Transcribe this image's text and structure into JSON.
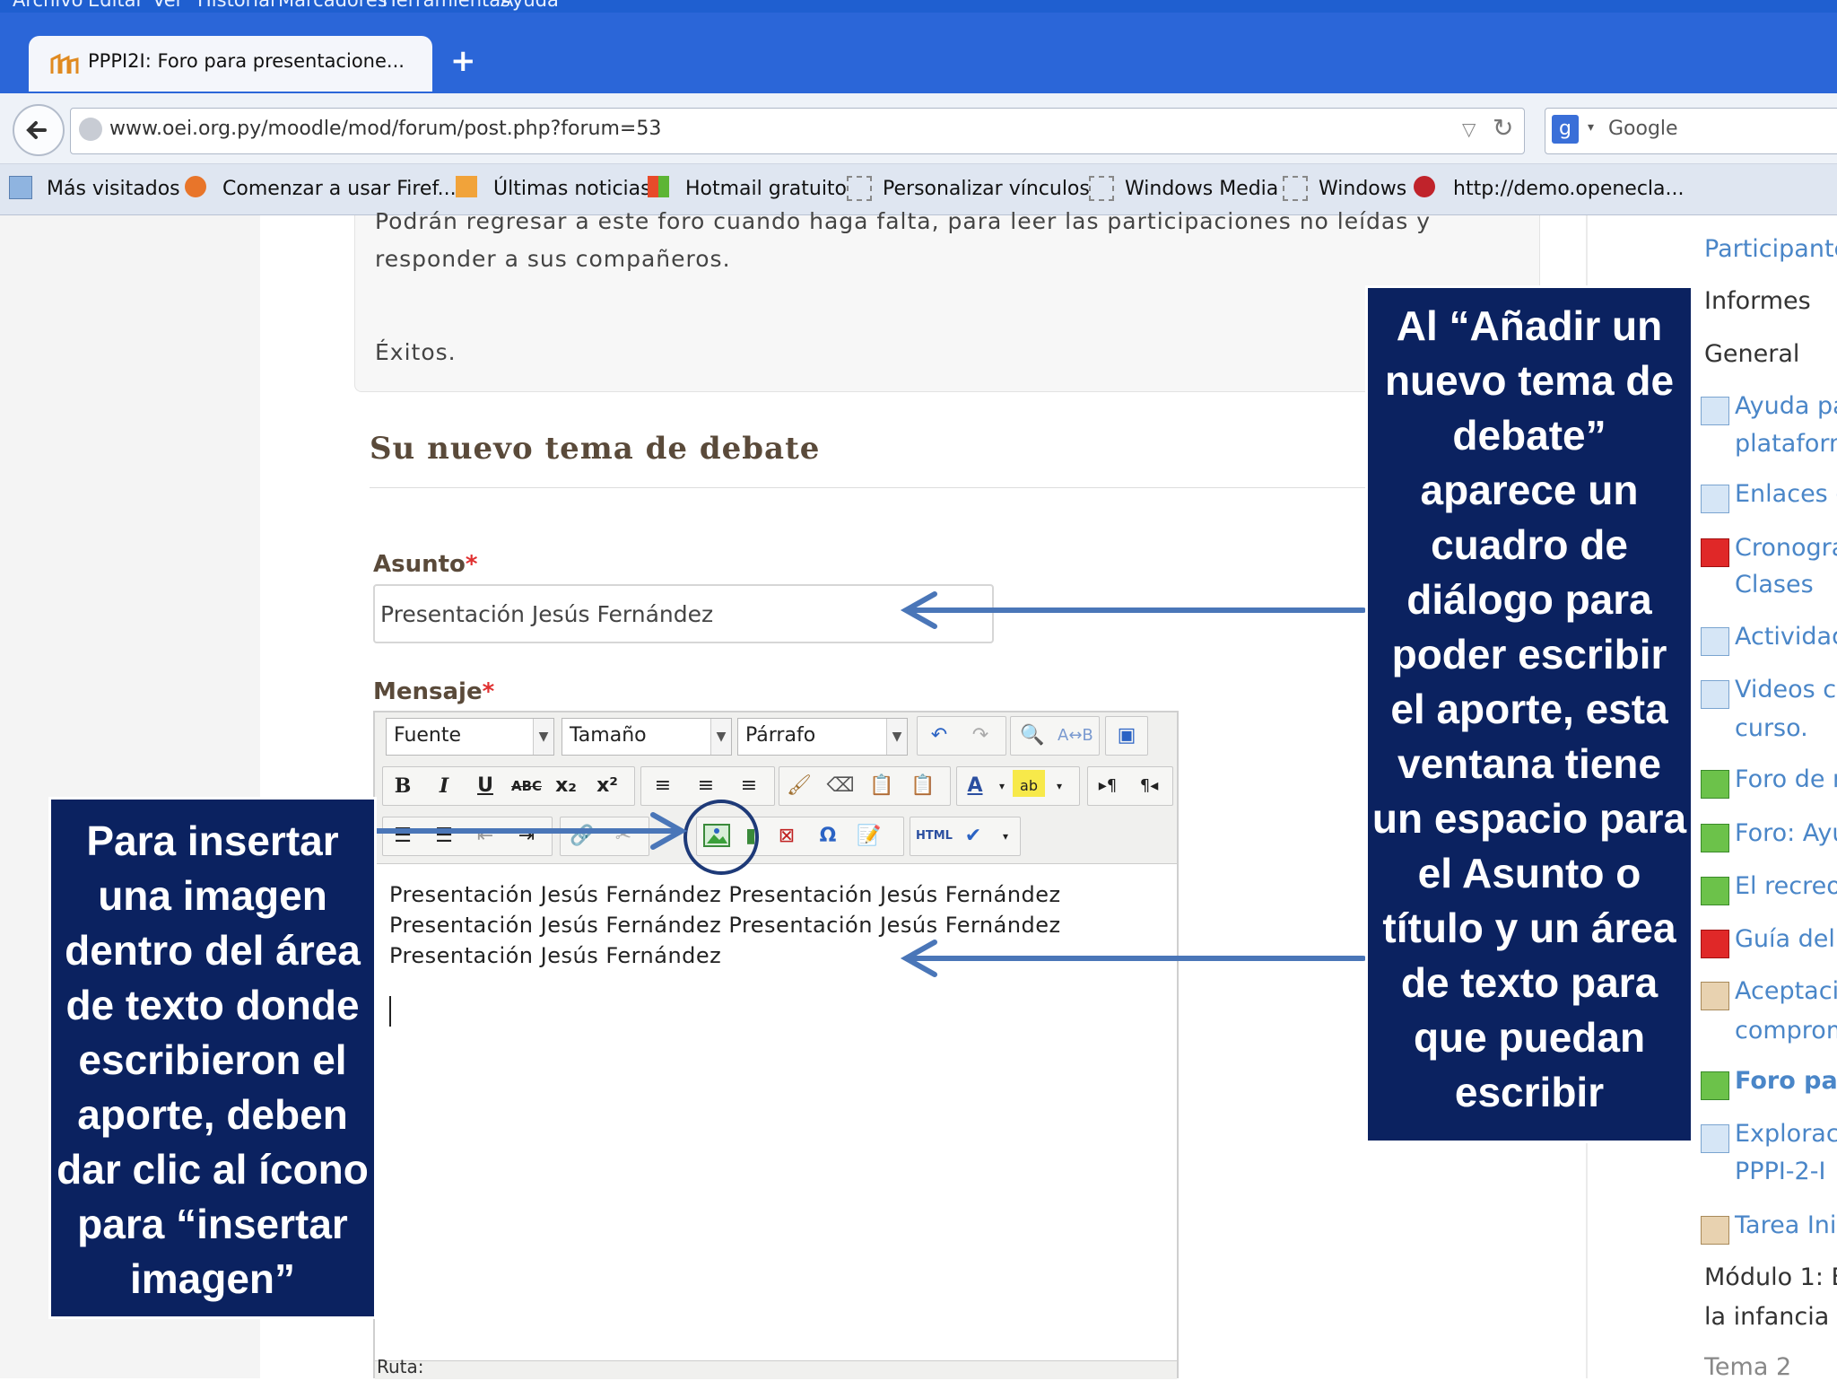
{
  "browser": {
    "menu": [
      "Archivo",
      "Editar",
      "Ver",
      "Historial",
      "Marcadores",
      "Herramientas",
      "Ayuda"
    ],
    "tab_title": "PPPI2I: Foro para presentacione...",
    "new_tab_label": "+",
    "url": "www.oei.org.py/moodle/mod/forum/post.php?forum=53",
    "search_placeholder": "Google",
    "bookmarks": [
      "Más visitados",
      "Comenzar a usar Firef...",
      "Últimas noticias",
      "Hotmail gratuito",
      "Personalizar vínculos",
      "Windows Media",
      "Windows",
      "http://demo.openecla..."
    ]
  },
  "page": {
    "intro_line1": "Podrán regresar a este foro cuando haga falta, para leer las participaciones no leídas y",
    "intro_line2": "responder a sus compañeros.",
    "intro_line3": "Éxitos.",
    "section_title": "Su nuevo tema de debate",
    "subject_label": "Asunto",
    "subject_value": "Presentación Jesús Fernández",
    "message_label": "Mensaje",
    "required_mark": "*",
    "toolbar": {
      "font_select": "Fuente",
      "size_select": "Tamaño",
      "format_select": "Párrafo"
    },
    "message_text": "Presentación Jesús Fernández Presentación Jesús Fernández Presentación Jesús Fernández Presentación Jesús Fernández Presentación Jesús Fernández",
    "path_label": "Ruta:"
  },
  "sidebar": {
    "items": [
      {
        "label": "Participante",
        "kind": "link"
      },
      {
        "label": "Informes",
        "kind": "plain"
      },
      {
        "label": "General",
        "kind": "plain"
      },
      {
        "label": "Ayuda pa",
        "kind": "link"
      },
      {
        "label": "plataform",
        "kind": "link"
      },
      {
        "label": "Enlaces d",
        "kind": "link"
      },
      {
        "label": "Cronogra",
        "kind": "link"
      },
      {
        "label": "Clases",
        "kind": "link"
      },
      {
        "label": "Actividade",
        "kind": "link"
      },
      {
        "label": "Videos co",
        "kind": "link"
      },
      {
        "label": "curso.",
        "kind": "link"
      },
      {
        "label": "Foro de n",
        "kind": "link"
      },
      {
        "label": "Foro: Ayu",
        "kind": "link"
      },
      {
        "label": "El recreo",
        "kind": "link"
      },
      {
        "label": "Guía del",
        "kind": "link"
      },
      {
        "label": "Aceptació",
        "kind": "link"
      },
      {
        "label": "comprom",
        "kind": "link"
      },
      {
        "label": "Foro par",
        "kind": "link"
      },
      {
        "label": "Exploraci",
        "kind": "link"
      },
      {
        "label": "PPPI-2-I",
        "kind": "link"
      },
      {
        "label": "Tarea Inic",
        "kind": "link"
      },
      {
        "label": "Módulo 1: E",
        "kind": "plain"
      },
      {
        "label": "la infancia",
        "kind": "plain"
      },
      {
        "label": "Tema 2",
        "kind": "plain"
      }
    ]
  },
  "callouts": {
    "right": [
      "Al “Añadir un",
      "nuevo tema de",
      "debate”",
      "aparece un",
      "cuadro de",
      "diálogo para",
      "poder escribir",
      "el aporte, esta",
      "ventana tiene",
      "un espacio para",
      "el Asunto o",
      "título y un área",
      "de texto para",
      "que puedan",
      "escribir"
    ],
    "left": [
      "Para insertar",
      "una imagen",
      "dentro del área",
      "de texto donde",
      "escribieron el",
      "aporte, deben",
      "dar clic al ícono",
      "para “insertar",
      "imagen”"
    ]
  },
  "colors": {
    "callout_bg": "#0b2260",
    "arrow": "#4a76b8",
    "link": "#4a86c8",
    "required": "#e03030"
  }
}
